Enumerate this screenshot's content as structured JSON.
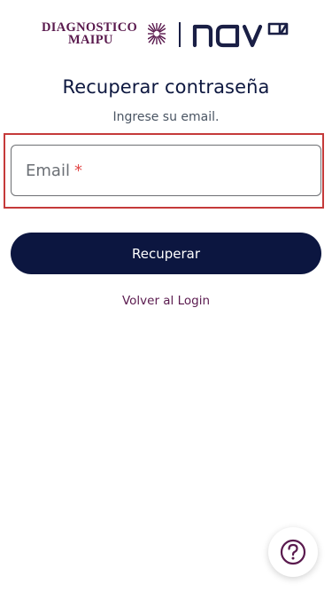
{
  "header": {
    "brand_left_line1": "DIAGNOSTICO",
    "brand_left_line2": "MAIPU",
    "brand_right": "nav"
  },
  "title": "Recuperar contraseña",
  "subtitle": "Ingrese su email.",
  "email_field": {
    "label": "Email",
    "required_marker": "*"
  },
  "recover_button_label": "Recuperar",
  "back_link_label": "Volver al Login",
  "help_icon": "question-circle-icon",
  "colors": {
    "brand_purple": "#5a1a4e",
    "navy": "#0c1640",
    "highlight_red": "#c53a3a",
    "required_red": "#e24848"
  }
}
